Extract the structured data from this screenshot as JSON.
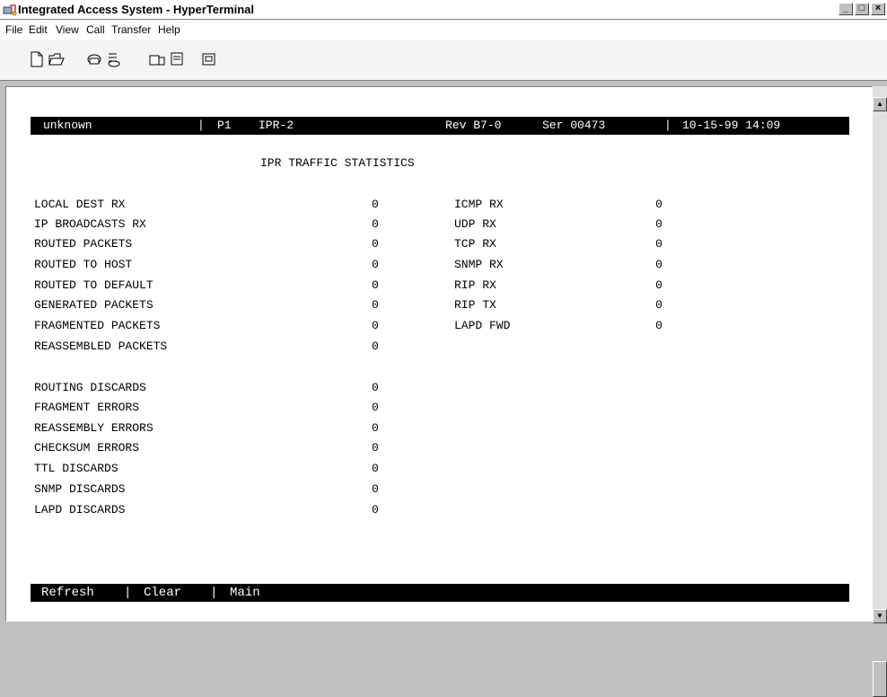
{
  "window": {
    "title": "Integrated Access System - HyperTerminal",
    "minimize_glyph": "_",
    "maximize_glyph": "□",
    "close_glyph": "×"
  },
  "menu": [
    "File",
    "Edit",
    "View",
    "Call",
    "Transfer",
    "Help"
  ],
  "toolbar": {
    "icons": [
      "new-icon",
      "open-icon",
      "connect-icon",
      "disconnect-icon",
      "send-icon",
      "receive-icon",
      "properties-icon"
    ]
  },
  "terminal": {
    "status": {
      "device": "unknown",
      "sep1": "|",
      "port": "P1",
      "module": "IPR-2",
      "rev": "Rev B7-0",
      "ser": "Ser 00473",
      "sep2": "|",
      "datetime": "10-15-99 14:09"
    },
    "screen_title": "IPR TRAFFIC STATISTICS",
    "left_stats": [
      {
        "label": "LOCAL DEST RX",
        "value": "0"
      },
      {
        "label": "IP BROADCASTS RX",
        "value": "0"
      },
      {
        "label": "ROUTED PACKETS",
        "value": "0"
      },
      {
        "label": "ROUTED TO HOST",
        "value": "0"
      },
      {
        "label": "ROUTED TO DEFAULT",
        "value": "0"
      },
      {
        "label": "GENERATED PACKETS",
        "value": "0"
      },
      {
        "label": "FRAGMENTED PACKETS",
        "value": "0"
      },
      {
        "label": "REASSEMBLED PACKETS",
        "value": "0"
      },
      {
        "label": "ROUTING DISCARDS",
        "value": "0"
      },
      {
        "label": "FRAGMENT ERRORS",
        "value": "0"
      },
      {
        "label": "REASSEMBLY ERRORS",
        "value": "0"
      },
      {
        "label": "CHECKSUM ERRORS",
        "value": "0"
      },
      {
        "label": "TTL DISCARDS",
        "value": "0"
      },
      {
        "label": "SNMP DISCARDS",
        "value": "0"
      },
      {
        "label": "LAPD DISCARDS",
        "value": "0"
      }
    ],
    "right_stats": [
      {
        "label": "ICMP RX",
        "value": "0"
      },
      {
        "label": "UDP RX",
        "value": "0"
      },
      {
        "label": "TCP RX",
        "value": "0"
      },
      {
        "label": "SNMP RX",
        "value": "0"
      },
      {
        "label": "RIP RX",
        "value": "0"
      },
      {
        "label": "RIP TX",
        "value": "0"
      },
      {
        "label": "LAPD FWD",
        "value": "0"
      }
    ],
    "commands": {
      "refresh": "Refresh",
      "sep1": "|",
      "clear": "Clear",
      "sep2": "|",
      "main": "Main"
    }
  },
  "scrollbar": {
    "up_glyph": "▲",
    "down_glyph": "▼"
  }
}
